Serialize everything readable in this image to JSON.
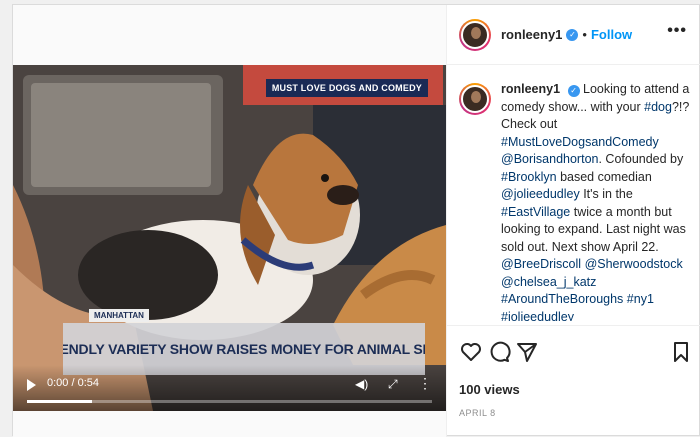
{
  "post": {
    "username": "ronleeny1",
    "separator": "•",
    "follow_label": "Follow",
    "more_label": "•••",
    "verified_mark": "✓",
    "caption": {
      "username": "ronleeny1",
      "t1": "Looking to attend a comedy show... with your ",
      "l1": "#dog",
      "t2": "?!? Check out ",
      "l2": "#MustLoveDogsandComedy",
      "t3": " ",
      "l3": "@Borisandhorton",
      "t4": ". Cofounded by ",
      "l4": "#Brooklyn",
      "t5": " based comedian ",
      "l5": "@jolieedudley",
      "t6": " It's in the ",
      "l6": "#EastVillage",
      "t7": " twice a month but looking to expand. Last night was sold out. Next show April 22. ",
      "l7": "@BreeDriscoll",
      "t8": " ",
      "l8": "@Sherwoodstock",
      "t9": " ",
      "l9": "@chelsea_j_katz",
      "t10": " ",
      "l10": "#AroundTheBoroughs",
      "t11": " ",
      "l11": "#ny1",
      "t12": " ",
      "l12": "#jolieedudley"
    },
    "views": "100 views",
    "date": "APRIL 8"
  },
  "video": {
    "chyron_top": "MUST LOVE DOGS AND COMEDY",
    "chyron_location": "MANHATTAN",
    "chyron_headline": "DOG FRIENDLY VARIETY SHOW RAISES MONEY FOR ANIMAL SHELTERS",
    "time": "0:00 / 0:54",
    "volume_icon": "◀)",
    "fullscreen_icon": "⤢",
    "more_icon": "⋮",
    "progress": 0.16
  },
  "colors": {
    "accent": "#0095f6",
    "link": "#00376b",
    "chyron_navy": "#1a2a55"
  },
  "icons": [
    "heart-icon",
    "comment-icon",
    "share-icon",
    "bookmark-icon",
    "play-icon",
    "volume-icon",
    "fullscreen-icon"
  ]
}
